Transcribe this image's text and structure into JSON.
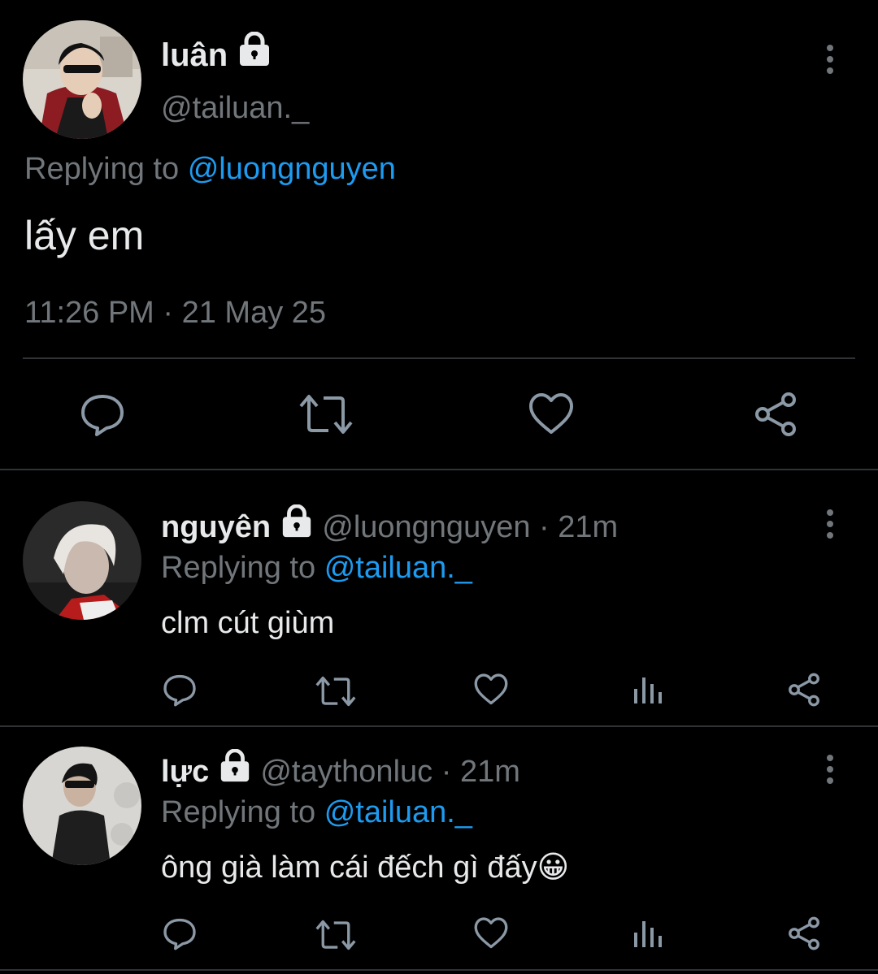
{
  "main_tweet": {
    "display_name": "luân",
    "handle": "@tailuan._",
    "replying_prefix": "Replying to",
    "replying_to": "@luongnguyen",
    "text": "lấy em",
    "timestamp": "11:26 PM · 21 May 25"
  },
  "replies": [
    {
      "display_name": "nguyên",
      "handle": "@luongnguyen",
      "separator": "·",
      "time": "21m",
      "replying_prefix": "Replying to",
      "replying_to": "@tailuan._",
      "text": "clm cút giùm"
    },
    {
      "display_name": "lực",
      "handle": "@taythonluc",
      "separator": "·",
      "time": "21m",
      "replying_prefix": "Replying to",
      "replying_to": "@tailuan._",
      "text": "ông già làm cái đếch gì đấy😀"
    }
  ],
  "icons": {
    "lock": "lock-icon",
    "more": "more-vertical-icon",
    "reply": "reply-icon",
    "retweet": "retweet-icon",
    "like": "heart-icon",
    "views": "views-icon",
    "share": "share-icon"
  },
  "colors": {
    "background": "#000000",
    "text": "#e7e9ea",
    "muted": "#71767b",
    "link": "#1d9bf0",
    "divider": "#2f3336"
  }
}
